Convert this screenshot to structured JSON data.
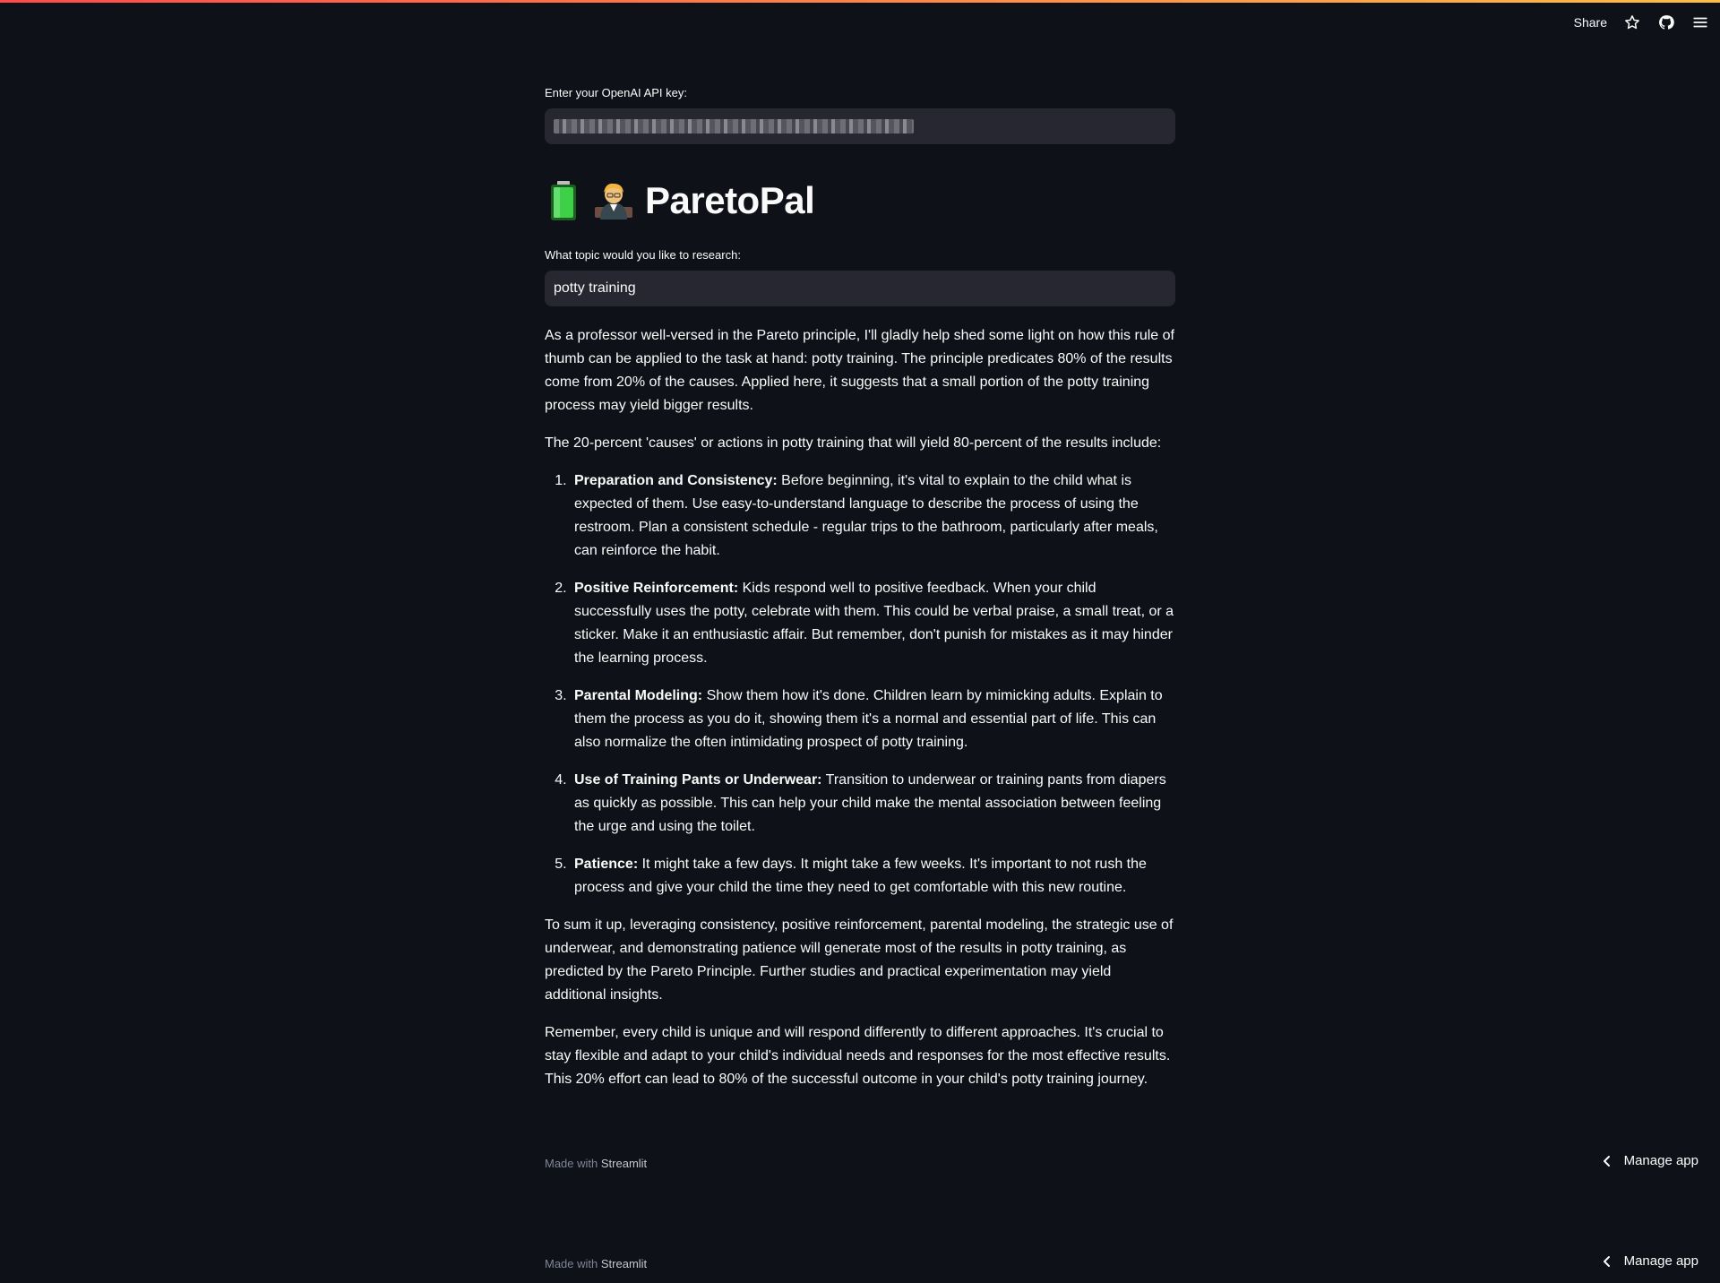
{
  "toolbar": {
    "share_label": "Share",
    "icons": [
      "star-icon",
      "github-icon",
      "hamburger-menu-icon"
    ]
  },
  "api_key": {
    "label": "Enter your OpenAI API key:"
  },
  "app": {
    "title": "ParetoPal",
    "title_emojis": [
      "battery-icon",
      "professor-icon"
    ]
  },
  "topic": {
    "label": "What topic would you like to research:",
    "value": "potty training"
  },
  "response": {
    "intro": "As a professor well-versed in the Pareto principle, I'll gladly help shed some light on how this rule of thumb can be applied to the task at hand: potty training. The principle predicates 80% of the results come from 20% of the causes. Applied here, it suggests that a small portion of the potty training process may yield bigger results.",
    "lead": "The 20-percent 'causes' or actions in potty training that will yield 80-percent of the results include:",
    "items": [
      {
        "title": "Preparation and Consistency:",
        "text": " Before beginning, it's vital to explain to the child what is expected of them. Use easy-to-understand language to describe the process of using the restroom. Plan a consistent schedule - regular trips to the bathroom, particularly after meals, can reinforce the habit."
      },
      {
        "title": "Positive Reinforcement:",
        "text": " Kids respond well to positive feedback. When your child successfully uses the potty, celebrate with them. This could be verbal praise, a small treat, or a sticker. Make it an enthusiastic affair. But remember, don't punish for mistakes as it may hinder the learning process."
      },
      {
        "title": "Parental Modeling:",
        "text": " Show them how it's done. Children learn by mimicking adults. Explain to them the process as you do it, showing them it's a normal and essential part of life. This can also normalize the often intimidating prospect of potty training."
      },
      {
        "title": "Use of Training Pants or Underwear:",
        "text": " Transition to underwear or training pants from diapers as quickly as possible. This can help your child make the mental association between feeling the urge and using the toilet."
      },
      {
        "title": "Patience:",
        "text": " It might take a few days. It might take a few weeks. It's important to not rush the process and give your child the time they need to get comfortable with this new routine."
      }
    ],
    "summary": "To sum it up, leveraging consistency, positive reinforcement, parental modeling, the strategic use of underwear, and demonstrating patience will generate most of the results in potty training, as predicted by the Pareto Principle. Further studies and practical experimentation may yield additional insights.",
    "closing": "Remember, every child is unique and will respond differently to different approaches. It's crucial to stay flexible and adapt to your child's individual needs and responses for the most effective results. This 20% effort can lead to 80% of the successful outcome in your child's potty training journey."
  },
  "footer": {
    "made_with": "Made with ",
    "brand": "Streamlit",
    "manage_label": "Manage app"
  },
  "colors": {
    "background": "#0e1117",
    "input_bg": "#262730",
    "text": "#fafafa",
    "muted": "#808495",
    "accent_start": "#ff4b4b",
    "accent_end": "#ffbd45"
  }
}
